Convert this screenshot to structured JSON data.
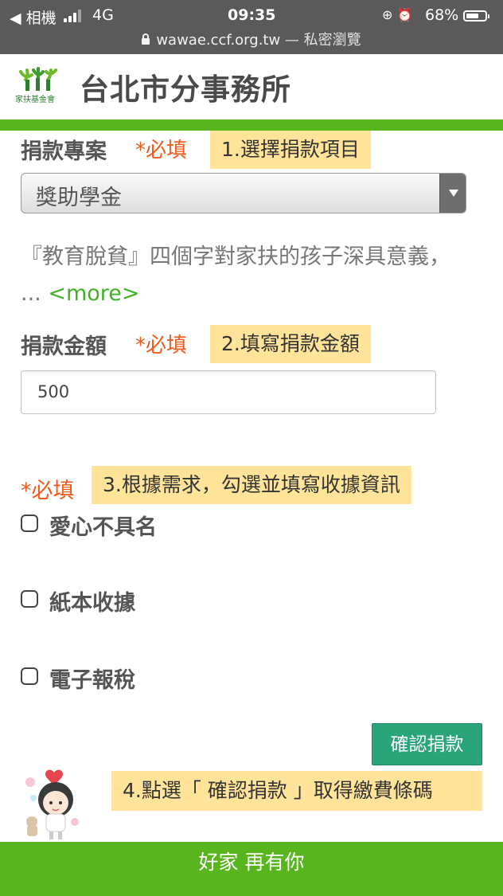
{
  "status_bar": {
    "carrier": "◀ 相機",
    "network": "4G",
    "time": "09:35",
    "battery_percent": "68%",
    "battery_level": 0.68,
    "url": "wawae.ccf.org.tw",
    "private_label": " — 私密瀏覽"
  },
  "header": {
    "logo_text": "家扶基金會",
    "title": "台北市分事務所"
  },
  "form": {
    "project_label": "捐款專案",
    "required_mark": "*必填",
    "project_note": "1.選擇捐款項目",
    "project_selected": "獎助學金",
    "description": "『教育脫貧』四個字對家扶的孩子深具意義，  ... ",
    "more_link": "<more>",
    "amount_label": "捐款金額",
    "amount_note": "2.填寫捐款金額",
    "amount_value": "500",
    "receipt_required": "*必填",
    "receipt_note": "3.根據需求，勾選並填寫收據資訊",
    "options": [
      {
        "label": "愛心不具名",
        "checked": false
      },
      {
        "label": "紙本收據",
        "checked": false
      },
      {
        "label": "電子報稅",
        "checked": false
      }
    ],
    "confirm_button": "確認捐款",
    "confirm_note": "4.點選「 確認捐款 」取得繳費條碼"
  },
  "footer": {
    "slogan": "好家 再有你"
  },
  "colors": {
    "accent_green": "#59b51d",
    "button_green": "#2aa57a",
    "required_orange": "#f05a1a",
    "note_yellow": "#ffe499",
    "link_green": "#43b02a"
  }
}
